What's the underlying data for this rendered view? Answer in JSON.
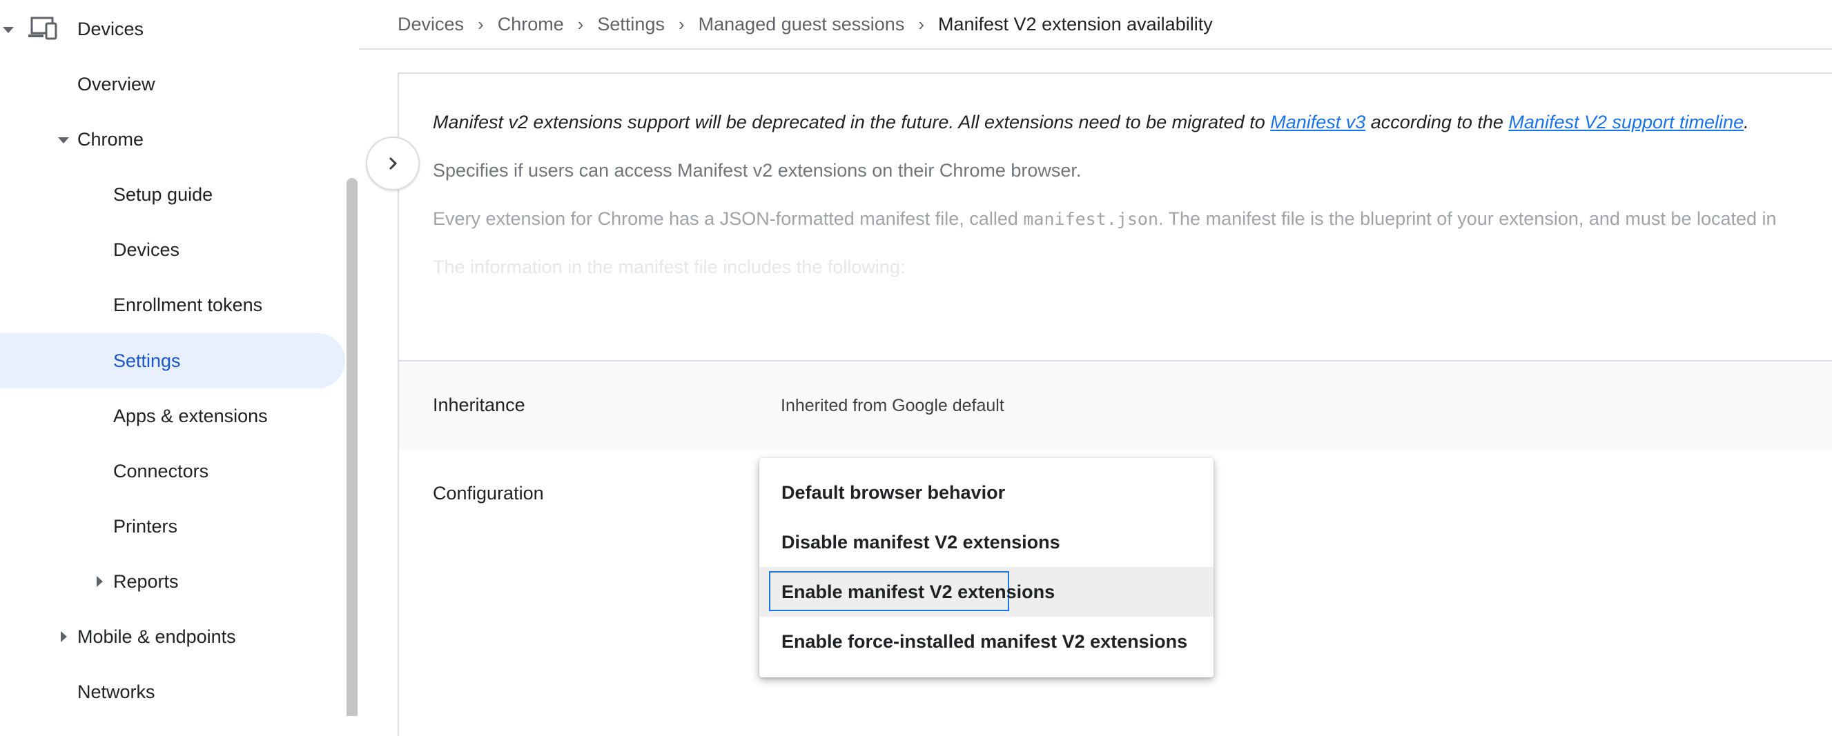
{
  "sidebar": {
    "devices": "Devices",
    "overview": "Overview",
    "chrome": "Chrome",
    "setup_guide": "Setup guide",
    "chrome_devices": "Devices",
    "enrollment_tokens": "Enrollment tokens",
    "settings": "Settings",
    "apps_extensions": "Apps & extensions",
    "connectors": "Connectors",
    "printers": "Printers",
    "reports": "Reports",
    "mobile_endpoints": "Mobile & endpoints",
    "networks": "Networks"
  },
  "breadcrumb": {
    "items": [
      "Devices",
      "Chrome",
      "Settings",
      "Managed guest sessions"
    ],
    "current": "Manifest V2 extension availability"
  },
  "description": {
    "line1_prefix": "Manifest v2 extensions support will be deprecated in the future. All extensions need to be migrated to ",
    "line1_link1": "Manifest v3",
    "line1_middle": " according to the ",
    "line1_link2": "Manifest V2 support timeline",
    "line1_suffix": ".",
    "line2": "Specifies if users can access Manifest v2 extensions on their Chrome browser.",
    "line3_prefix": "Every extension for Chrome has a JSON-formatted manifest file, called ",
    "line3_code": "manifest.json",
    "line3_suffix": ". The manifest file is the blueprint of your extension, and must be located in",
    "line4": "The information in the manifest file includes the following:"
  },
  "inheritance": {
    "label": "Inheritance",
    "value": "Inherited from Google default"
  },
  "configuration": {
    "label": "Configuration",
    "options": [
      "Default browser behavior",
      "Disable manifest V2 extensions",
      "Enable manifest V2 extensions",
      "Enable force-installed manifest V2 extensions"
    ],
    "selected_index": 2
  },
  "colors": {
    "accent": "#1a73e8",
    "selected_bg": "#e8f0fe"
  }
}
